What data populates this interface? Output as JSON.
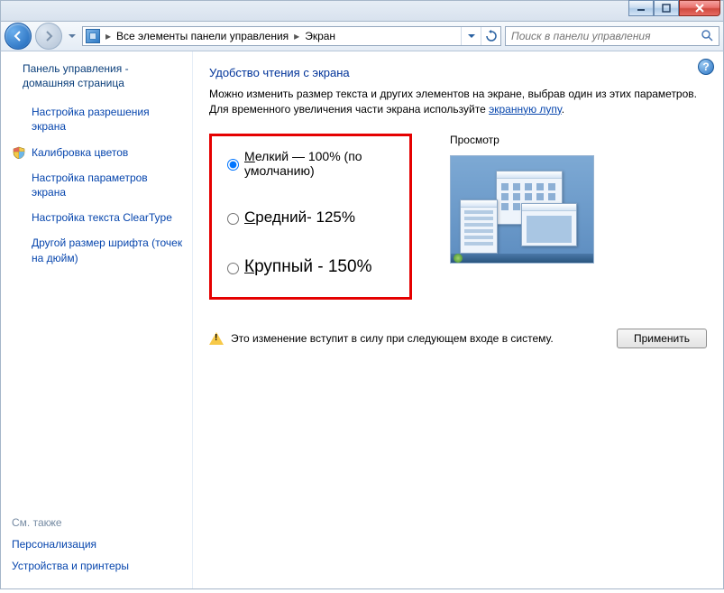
{
  "window": {
    "minimize": "–",
    "maximize": "□",
    "close": "×"
  },
  "nav": {
    "breadcrumb_root": "Все элементы панели управления",
    "breadcrumb_current": "Экран",
    "search_placeholder": "Поиск в панели управления"
  },
  "sidebar": {
    "home_label": "Панель управления - домашняя страница",
    "tasks": [
      {
        "label": "Настройка разрешения экрана",
        "has_icon": false
      },
      {
        "label": "Калибровка цветов",
        "has_icon": true
      },
      {
        "label": "Настройка параметров экрана",
        "has_icon": false
      },
      {
        "label": "Настройка текста ClearType",
        "has_icon": false
      },
      {
        "label": "Другой размер шрифта (точек на дюйм)",
        "has_icon": false
      }
    ],
    "see_also_header": "См. также",
    "see_also": [
      {
        "label": "Персонализация"
      },
      {
        "label": "Устройства и принтеры"
      }
    ]
  },
  "main": {
    "title": "Удобство чтения с экрана",
    "desc_line1": "Можно изменить размер текста и других элементов на экране, выбрав один из этих параметров.",
    "desc_line2_prefix": "Для временного увеличения части экрана используйте ",
    "desc_link": "экранную лупу",
    "desc_line2_suffix": ".",
    "options": [
      {
        "first": "М",
        "rest": "елкий — 100% (по умолчанию)",
        "checked": true,
        "cls": "small"
      },
      {
        "first": "С",
        "rest": "редний- 125%",
        "checked": false,
        "cls": "medium"
      },
      {
        "first": "К",
        "rest": "рупный - 150%",
        "checked": false,
        "cls": "large"
      }
    ],
    "preview_label": "Просмотр",
    "notice_text": "Это изменение вступит в силу при следующем входе в систему.",
    "apply_label": "Применить",
    "help_symbol": "?"
  }
}
